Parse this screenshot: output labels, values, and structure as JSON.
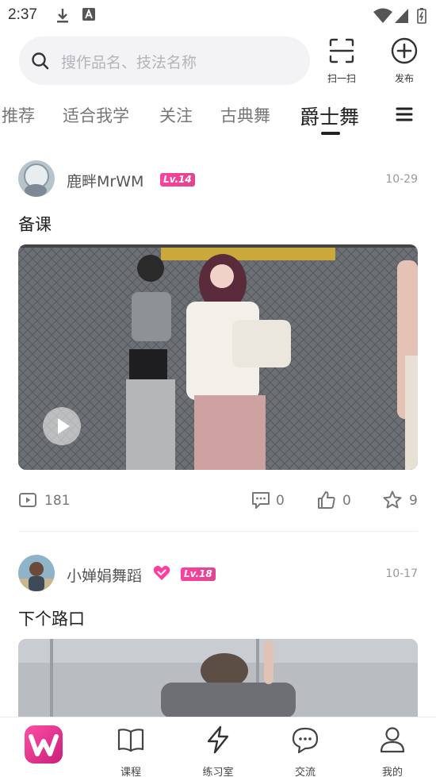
{
  "status": {
    "time": "2:37"
  },
  "search": {
    "placeholder": "搜作品名、技法名称"
  },
  "header": {
    "scan_label": "扫一扫",
    "publish_label": "发布"
  },
  "tabs": [
    {
      "label": "推荐",
      "active": false
    },
    {
      "label": "适合我学",
      "active": false
    },
    {
      "label": "关注",
      "active": false
    },
    {
      "label": "古典舞",
      "active": false
    },
    {
      "label": "爵士舞",
      "active": true
    }
  ],
  "posts": [
    {
      "author": "鹿畔MrWM",
      "level": "Lv.14",
      "date": "10-29",
      "title": "备课",
      "views": "181",
      "comments": "0",
      "likes": "0",
      "favorites": "9"
    },
    {
      "author": "小婵娟舞蹈",
      "level": "Lv.18",
      "date": "10-17",
      "title": "下个路口"
    }
  ],
  "bottom_nav": [
    {
      "label": "课程"
    },
    {
      "label": "练习室"
    },
    {
      "label": "交流"
    },
    {
      "label": "我的"
    }
  ],
  "colors": {
    "brand": "#e63d94",
    "badge": "#ff3fa0",
    "text": "#222222",
    "muted": "#999999"
  }
}
